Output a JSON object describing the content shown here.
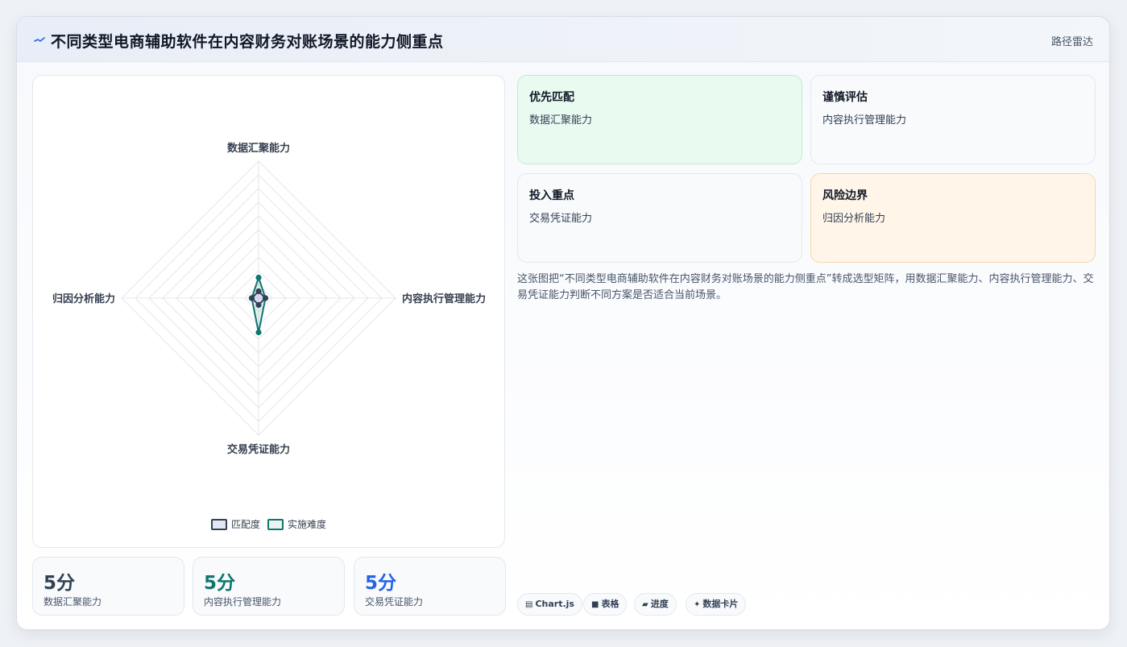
{
  "header": {
    "title": "不同类型电商辅助软件在内容财务对账场景的能力侧重点",
    "right_label": "路径雷达"
  },
  "chart_data": {
    "type": "radar",
    "axes": [
      "数据汇聚能力",
      "内容执行管理能力",
      "交易凭证能力",
      "归因分析能力"
    ],
    "series": [
      {
        "name": "匹配度",
        "values": [
          5,
          5,
          5,
          5
        ],
        "color": "#334155"
      },
      {
        "name": "实施难度",
        "values": [
          15,
          5,
          25,
          5
        ],
        "color": "#0f766e"
      }
    ],
    "rlim": [
      0,
      100
    ],
    "grid_levels": 10,
    "legend_position": "bottom"
  },
  "stats": [
    {
      "value": "5分",
      "label": "数据汇聚能力",
      "color": "#334155"
    },
    {
      "value": "5分",
      "label": "内容执行管理能力",
      "color": "#0f766e"
    },
    {
      "value": "5分",
      "label": "交易凭证能力",
      "color": "#2563eb"
    }
  ],
  "cards": [
    {
      "title": "优先匹配",
      "subtitle": "数据汇聚能力"
    },
    {
      "title": "谨慎评估",
      "subtitle": "内容执行管理能力"
    },
    {
      "title": "投入重点",
      "subtitle": "交易凭证能力"
    },
    {
      "title": "风险边界",
      "subtitle": "归因分析能力"
    }
  ],
  "description": "这张图把“不同类型电商辅助软件在内容财务对账场景的能力侧重点”转成选型矩阵，用数据汇聚能力、内容执行管理能力、交易凭证能力判断不同方案是否适合当前场景。",
  "chips": [
    {
      "icon": "▤",
      "icon_name": "table-icon",
      "label": "Chart.js"
    },
    {
      "icon": "■",
      "icon_name": "grid-icon",
      "label": "表格"
    },
    {
      "icon": "▰",
      "icon_name": "progress-icon",
      "label": "进度"
    },
    {
      "icon": "✦",
      "icon_name": "sparkle-icon",
      "label": "数据卡片"
    }
  ]
}
